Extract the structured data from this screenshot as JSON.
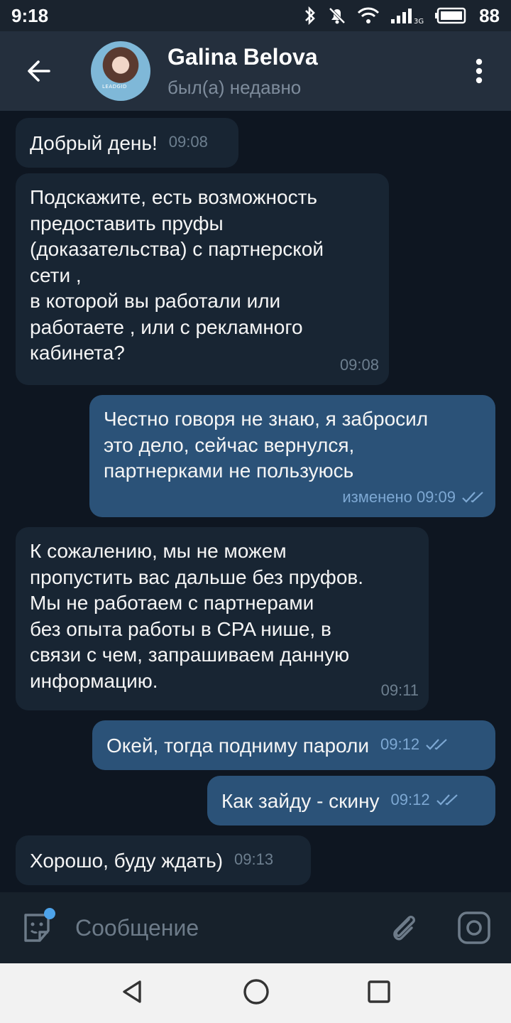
{
  "status_bar": {
    "time": "9:18",
    "battery": "88",
    "network": "3G"
  },
  "header": {
    "name": "Galina Belova",
    "status": "был(а) недавно",
    "avatar_badge": "LEADGID"
  },
  "messages": [
    {
      "dir": "in",
      "text": "Добрый день!",
      "time": "09:08"
    },
    {
      "dir": "in",
      "text": "Подскажите, есть возможность\nпредоставить пруфы\n(доказательства) с партнерской\nсети ,\nв которой вы работали или\nработаете , или с рекламного\nкабинета?",
      "time": "09:08"
    },
    {
      "dir": "out",
      "text": "Честно говоря не знаю, я забросил\nэто дело, сейчас вернулся,\nпартнерками не пользуюсь",
      "time": "изменено 09:09"
    },
    {
      "dir": "in",
      "text": "К сожалению, мы не можем\nпропустить вас дальше без пруфов.\nМы не работаем с партнерами\nбез опыта работы в CPA нише, в\nсвязи с чем, запрашиваем данную\nинформацию.",
      "time": "09:11"
    },
    {
      "dir": "out",
      "text": "Окей, тогда подниму пароли",
      "time": "09:12"
    },
    {
      "dir": "out",
      "text": "Как зайду - скину",
      "time": "09:12"
    },
    {
      "dir": "in",
      "text": "Хорошо, буду ждать)",
      "time": "09:13"
    }
  ],
  "input": {
    "placeholder": "Сообщение"
  },
  "icons": {
    "back": "arrow-left-icon",
    "menu": "more-vertical-icon",
    "sticker": "sticker-icon",
    "attach": "paperclip-icon",
    "camera": "camera-icon",
    "read": "double-check-icon"
  },
  "colors": {
    "header_bg": "#242f3d",
    "chat_bg": "#0e1621",
    "incoming_bubble": "#182533",
    "outgoing_bubble": "#2b5278",
    "accent": "#4da3ea"
  }
}
